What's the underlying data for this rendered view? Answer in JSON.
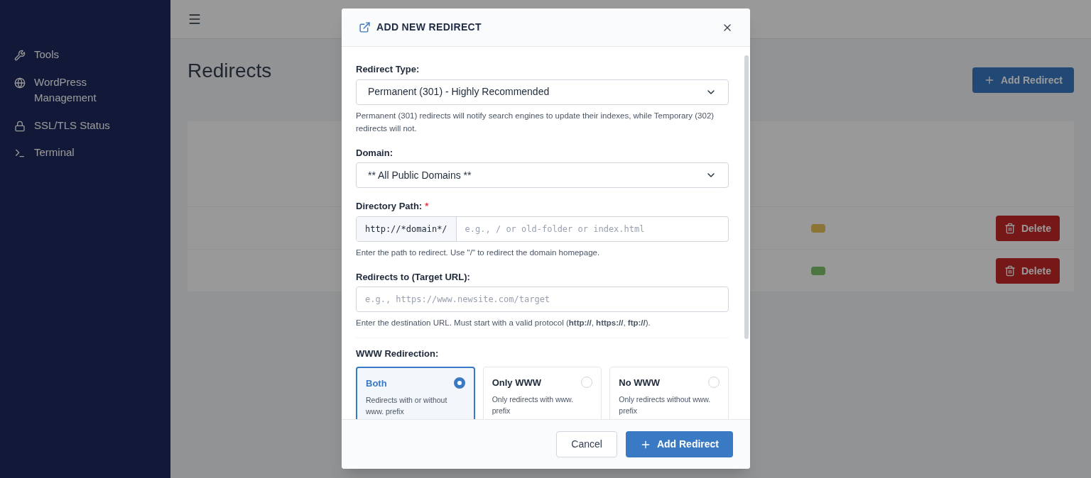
{
  "sidebar": {
    "items": [
      {
        "label": "Tools"
      },
      {
        "label": "WordPress Management"
      },
      {
        "label": "SSL/TLS Status"
      },
      {
        "label": "Terminal"
      }
    ]
  },
  "page": {
    "title": "Redirects",
    "add_button": "Add Redirect",
    "rows": [
      {
        "action": "Delete",
        "color": "#8b7436"
      },
      {
        "action": "Delete",
        "color": "#4c753f"
      }
    ]
  },
  "modal": {
    "title": "ADD NEW REDIRECT",
    "fields": [
      {
        "kind": "select",
        "label": "Redirect Type:",
        "value": "Permanent (301) - Highly Recommended",
        "help": "Permanent (301) redirects will notify search engines to update their indexes, while Temporary (302) redirects will not."
      },
      {
        "kind": "select",
        "label": "Domain:",
        "value": "** All Public Domains **"
      },
      {
        "kind": "prefixed",
        "label": "Directory Path:",
        "required_mark": "*",
        "prefix": "http://*domain*/",
        "placeholder": "e.g., / or old-folder or index.html",
        "help": "Enter the path to redirect. Use \"/\" to redirect the domain homepage."
      },
      {
        "kind": "text",
        "label": "Redirects to (Target URL):",
        "placeholder": "e.g., https://www.newsite.com/target",
        "help": "Enter the destination URL. Must start with a valid protocol (**http://**, **https://**, **ftp://**)."
      }
    ],
    "www": {
      "label": "WWW Redirection:",
      "options": [
        {
          "title": "Both",
          "description": "Redirects with or without www. prefix",
          "selected": true
        },
        {
          "title": "Only WWW",
          "description": "Only redirects with www. prefix",
          "selected": false
        },
        {
          "title": "No WWW",
          "description": "Only redirects without www. prefix",
          "selected": false
        }
      ]
    },
    "buttons": [
      {
        "kind": "secondary",
        "label": "Cancel"
      },
      {
        "kind": "primary",
        "label": "Add Redirect"
      }
    ]
  }
}
